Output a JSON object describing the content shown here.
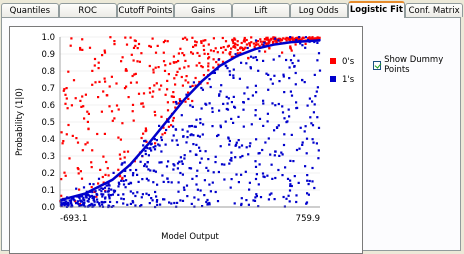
{
  "tabs": [
    {
      "label": "Quantiles"
    },
    {
      "label": "ROC"
    },
    {
      "label": "Cutoff Points"
    },
    {
      "label": "Gains"
    },
    {
      "label": "Lift"
    },
    {
      "label": "Log Odds"
    },
    {
      "label": "Logistic Fit",
      "active": true
    },
    {
      "label": "Conf. Matrix"
    }
  ],
  "options": {
    "show_dummy_points_label": "Show Dummy Points",
    "show_dummy_points_checked": true
  },
  "chart_data": {
    "type": "scatter",
    "xlabel": "Model Output",
    "ylabel": "Probability (1|0)",
    "x_tick_labels": [
      "-693.1",
      "759.9"
    ],
    "xlim": [
      -693.1,
      759.9
    ],
    "ylim": [
      0,
      1
    ],
    "y_ticks": [
      "0.0",
      "0.1",
      "0.2",
      "0.3",
      "0.4",
      "0.5",
      "0.6",
      "0.7",
      "0.8",
      "0.9",
      "1.0"
    ],
    "legend_position": "right",
    "series": [
      {
        "name": "0's",
        "color": "#ff0000",
        "count": 480,
        "x_range": [
          -693.1,
          759.9
        ],
        "region": "above logistic curve"
      },
      {
        "name": "1's",
        "color": "#0000cc",
        "count": 650,
        "x_range": [
          -693.1,
          759.9
        ],
        "region": "below logistic curve"
      }
    ],
    "fit_curve": {
      "color": "#0000cc",
      "points": [
        [
          -693.1,
          0.04
        ],
        [
          -550,
          0.08
        ],
        [
          -400,
          0.16
        ],
        [
          -300,
          0.25
        ],
        [
          -200,
          0.37
        ],
        [
          -100,
          0.5
        ],
        [
          0,
          0.63
        ],
        [
          100,
          0.74
        ],
        [
          200,
          0.83
        ],
        [
          300,
          0.89
        ],
        [
          400,
          0.93
        ],
        [
          500,
          0.955
        ],
        [
          600,
          0.97
        ],
        [
          759.9,
          0.98
        ]
      ]
    }
  },
  "colors": {
    "zero_color": "#ff0000",
    "one_color": "#0000cc"
  }
}
